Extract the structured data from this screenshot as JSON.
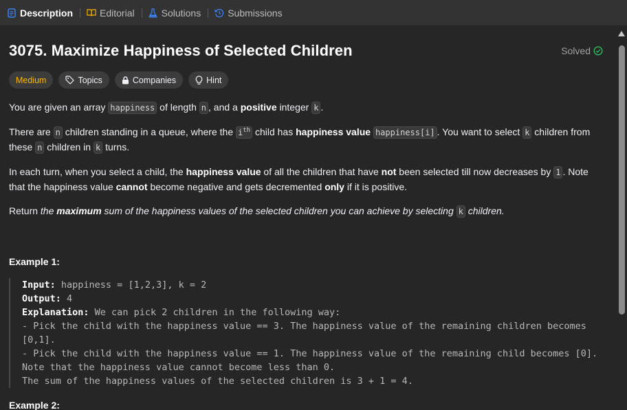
{
  "tabs": [
    {
      "label": "Description",
      "icon": "description-icon",
      "color": "#3b82f6"
    },
    {
      "label": "Editorial",
      "icon": "book-icon",
      "color": "#ffb800"
    },
    {
      "label": "Solutions",
      "icon": "flask-icon",
      "color": "#3b82f6"
    },
    {
      "label": "Submissions",
      "icon": "history-icon",
      "color": "#3b82f6"
    }
  ],
  "problem": {
    "title": "3075. Maximize Happiness of Selected Children",
    "status": "Solved",
    "difficulty": "Medium",
    "chips": [
      "Topics",
      "Companies",
      "Hint"
    ]
  },
  "colors": {
    "medium": "#ffb800",
    "solved_check": "#2cbb5d",
    "background": "#262626"
  },
  "description": {
    "p1": {
      "t1": "You are given an array ",
      "c1": "happiness",
      "t2": " of length ",
      "c2": "n",
      "t3": ", and a ",
      "b1": "positive",
      "t4": " integer ",
      "c3": "k",
      "t5": "."
    },
    "p2": {
      "t1": "There are ",
      "c1": "n",
      "t2": " children standing in a queue, where the ",
      "c2a": "i",
      "c2sup": "th",
      "t3": " child has ",
      "b1": "happiness value",
      "t4": " ",
      "c3": "happiness[i]",
      "t5": ". You want to select ",
      "c4": "k",
      "t6": " children from these ",
      "c5": "n",
      "t7": " children in ",
      "c6": "k",
      "t8": " turns."
    },
    "p3": {
      "t1": "In each turn, when you select a child, the ",
      "b1": "happiness value",
      "t2": " of all the children that have ",
      "b2": "not",
      "t3": " been selected till now decreases by ",
      "c1": "1",
      "t4": ". Note that the happiness value ",
      "b3": "cannot",
      "t5": " become negative and gets decremented ",
      "b4": "only",
      "t6": " if it is positive."
    },
    "p4": {
      "t1": "Return ",
      "i1": "the ",
      "bi": "maximum",
      "i2": " sum of the happiness values of the selected children you can achieve by selecting ",
      "c1": "k",
      "i3": " children."
    }
  },
  "example1": {
    "title": "Example 1:",
    "input_label": "Input:",
    "input_value": " happiness = [1,2,3], k = 2",
    "output_label": "Output:",
    "output_value": " 4",
    "explanation_label": "Explanation:",
    "explanation_value": " We can pick 2 children in the following way:",
    "line1": "- Pick the child with the happiness value == 3. The happiness value of the remaining children becomes [0,1].",
    "line2": "- Pick the child with the happiness value == 1. The happiness value of the remaining child becomes [0]. Note that the happiness value cannot become less than 0.",
    "line3": "The sum of the happiness values of the selected children is 3 + 1 = 4."
  },
  "example2": {
    "title": "Example 2:"
  }
}
